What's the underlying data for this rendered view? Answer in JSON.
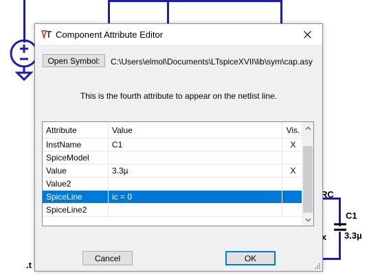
{
  "schematic": {
    "rc_label": "RC",
    "cap_name": "C1",
    "cap_value": "3.3µ",
    "side_text": "x",
    "bottom_text": ".t"
  },
  "dialog": {
    "title": "Component Attribute Editor",
    "open_symbol_label": "Open Symbol:",
    "symbol_path": "C:\\Users\\elmol\\Documents\\LTspiceXVII\\lib\\sym\\cap.asy",
    "description": "This is the fourth attribute to appear on the netlist line.",
    "cancel_label": "Cancel",
    "ok_label": "OK"
  },
  "grid": {
    "headers": [
      "Attribute",
      "Value",
      "Vis."
    ],
    "rows": [
      {
        "attribute": "InstName",
        "value": "C1",
        "vis": "X"
      },
      {
        "attribute": "SpiceModel",
        "value": "",
        "vis": ""
      },
      {
        "attribute": "Value",
        "value": "3.3µ",
        "vis": "X"
      },
      {
        "attribute": "Value2",
        "value": "",
        "vis": ""
      },
      {
        "attribute": "SpiceLine",
        "value": "ic = 0",
        "vis": ""
      },
      {
        "attribute": "SpiceLine2",
        "value": "",
        "vis": ""
      }
    ],
    "selected_index": 4
  },
  "colors": {
    "wire": "#1b1bb0",
    "selection": "#0078d7",
    "dialog_bg": "#f0f0f0"
  }
}
